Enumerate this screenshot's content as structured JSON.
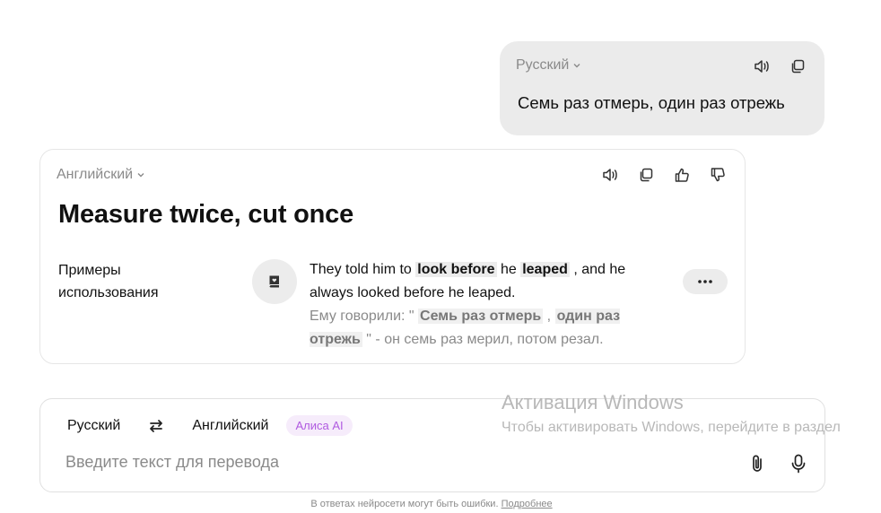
{
  "source": {
    "language": "Русский",
    "text": "Семь раз отмерь, один раз отрежь",
    "icons": [
      "speaker-icon",
      "copy-icon"
    ]
  },
  "translation": {
    "language": "Английский",
    "text": "Measure twice, cut once",
    "icons": [
      "speaker-icon",
      "copy-icon",
      "thumbs-up-icon",
      "thumbs-down-icon"
    ],
    "examples_label": "Примеры использования",
    "example": {
      "en": [
        "They told him to ",
        "look before",
        " he ",
        "leaped",
        " , and he always looked before he leaped."
      ],
      "ru": [
        "Ему говорили: \" ",
        "Семь раз отмерь",
        " , ",
        "один раз отрежь",
        " \" - он семь раз мерил, потом резал."
      ]
    }
  },
  "input": {
    "from_language": "Русский",
    "to_language": "Английский",
    "alisa_label": "Алиса AI",
    "placeholder": "Введите текст для перевода"
  },
  "footer": {
    "disclaimer": "В ответах нейросети могут быть ошибки.",
    "link": "Подробнее"
  },
  "watermark": {
    "title": "Активация Windows",
    "subtitle": "Чтобы активировать Windows, перейдите в раздел"
  },
  "colors": {
    "accent_purple": "#b05ae0",
    "bubble_gray": "#ebebeb"
  }
}
